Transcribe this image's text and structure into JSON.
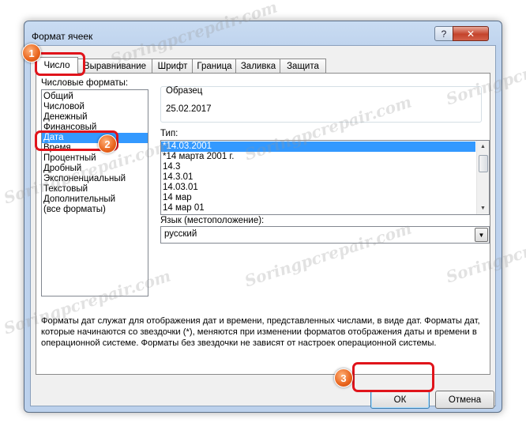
{
  "window": {
    "title": "Формат ячеек",
    "help": "?",
    "close": "✕"
  },
  "tabs": [
    {
      "label": "Число"
    },
    {
      "label": "Выравнивание"
    },
    {
      "label": "Шрифт"
    },
    {
      "label": "Граница"
    },
    {
      "label": "Заливка"
    },
    {
      "label": "Защита"
    }
  ],
  "number_formats": {
    "label": "Числовые форматы:",
    "items": [
      "Общий",
      "Числовой",
      "Денежный",
      "Финансовый",
      "Дата",
      "Время",
      "Процентный",
      "Дробный",
      "Экспоненциальный",
      "Текстовый",
      "Дополнительный",
      "(все форматы)"
    ],
    "selected": "Дата"
  },
  "sample": {
    "label": "Образец",
    "value": "25.02.2017"
  },
  "type": {
    "label": "Тип:",
    "items": [
      "*14.03.2001",
      "*14 марта 2001 г.",
      "14.3",
      "14.3.01",
      "14.03.01",
      "14 мар",
      "14 мар 01"
    ],
    "selected": "*14.03.2001"
  },
  "language": {
    "label": "Язык (местоположение):",
    "value": "русский"
  },
  "description": {
    "line1": "Форматы дат служат для отображения дат и времени, представленных числами, в виде дат. Форматы дат,",
    "line2": "которые начинаются со звездочки (*), меняются при изменении форматов отображения даты и времени в",
    "line3": "операционной системе. Форматы без звездочки не зависят от настроек операционной системы."
  },
  "buttons": {
    "ok": "ОК",
    "cancel": "Отмена"
  },
  "annotations": {
    "badge1": "1",
    "badge2": "2",
    "badge3": "3",
    "color": "#e0141b"
  },
  "watermark": "Soringpcrepair.com"
}
